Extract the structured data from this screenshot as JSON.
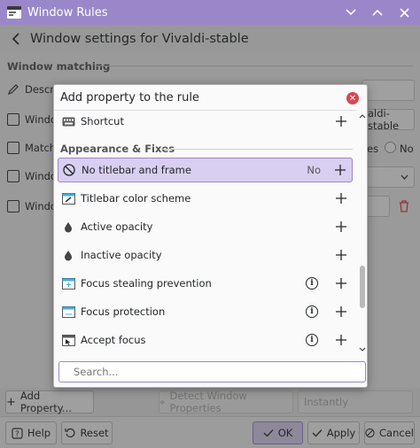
{
  "window": {
    "title": "Window Rules"
  },
  "header": {
    "title": "Window settings for Vivaldi-stable"
  },
  "matching": {
    "section": "Window matching",
    "rows": [
      "Descri",
      "Windo",
      "Match",
      "Windo",
      "Windo"
    ],
    "wmclass_value": "aldi-stable",
    "radio_yes": "es",
    "radio_no": "No"
  },
  "dialog": {
    "title": "Add property to the rule",
    "group": "Appearance & Fixes",
    "items": [
      {
        "label": "Shortcut",
        "icon": "keyboard-icon"
      },
      {
        "label": "No titlebar and frame",
        "value": "No",
        "icon": "no-titlebar-icon"
      },
      {
        "label": "Titlebar color scheme",
        "icon": "color-scheme-icon"
      },
      {
        "label": "Active opacity",
        "icon": "opacity-drop-icon"
      },
      {
        "label": "Inactive opacity",
        "icon": "opacity-drop-icon"
      },
      {
        "label": "Focus stealing prevention",
        "icon": "focus-window-icon"
      },
      {
        "label": "Focus protection",
        "icon": "focus-window-icon"
      },
      {
        "label": "Accept focus",
        "icon": "cursor-window-icon"
      }
    ],
    "search_placeholder": "Search..."
  },
  "bottombar": {
    "add_property": "Add Property...",
    "detect": "Detect Window Properties",
    "instantly": "Instantly"
  },
  "footer": {
    "help": "Help",
    "reset": "Reset",
    "ok": "OK",
    "apply": "Apply",
    "cancel": "Cancel"
  },
  "colors": {
    "accent": "#9a87c9",
    "selection": "#d9cff0",
    "close": "#da4453"
  }
}
